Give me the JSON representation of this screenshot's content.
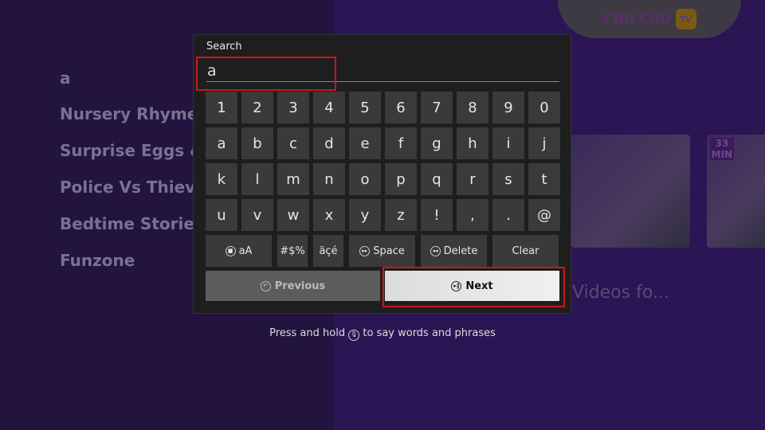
{
  "logo": {
    "text": "CHU CHU",
    "badge": "TV"
  },
  "sidebar": {
    "query": "a",
    "items": [
      "Nursery Rhymes &",
      "Surprise Eggs & L",
      "Police Vs Thieves",
      "Bedtime Stories &",
      "Funzone"
    ]
  },
  "content": {
    "thumb_badge": "33 MIN",
    "row_title": "Videos fo..."
  },
  "search": {
    "label": "Search",
    "value": "a",
    "rows": [
      [
        "1",
        "2",
        "3",
        "4",
        "5",
        "6",
        "7",
        "8",
        "9",
        "0"
      ],
      [
        "a",
        "b",
        "c",
        "d",
        "e",
        "f",
        "g",
        "h",
        "i",
        "j"
      ],
      [
        "k",
        "l",
        "m",
        "n",
        "o",
        "p",
        "q",
        "r",
        "s",
        "t"
      ],
      [
        "u",
        "v",
        "w",
        "x",
        "y",
        "z",
        "!",
        ",",
        ".",
        "@"
      ]
    ],
    "case_label": "aA",
    "symbols_label": "#$%",
    "accents_label": "äçé",
    "space_label": "Space",
    "delete_label": "Delete",
    "clear_label": "Clear",
    "previous_label": "Previous",
    "next_label": "Next"
  },
  "hint": {
    "before": "Press and hold",
    "after": "to say words and phrases",
    "icon": "microphone-icon"
  },
  "colors": {
    "highlight": "#d0141e",
    "background": "#2a1550"
  }
}
